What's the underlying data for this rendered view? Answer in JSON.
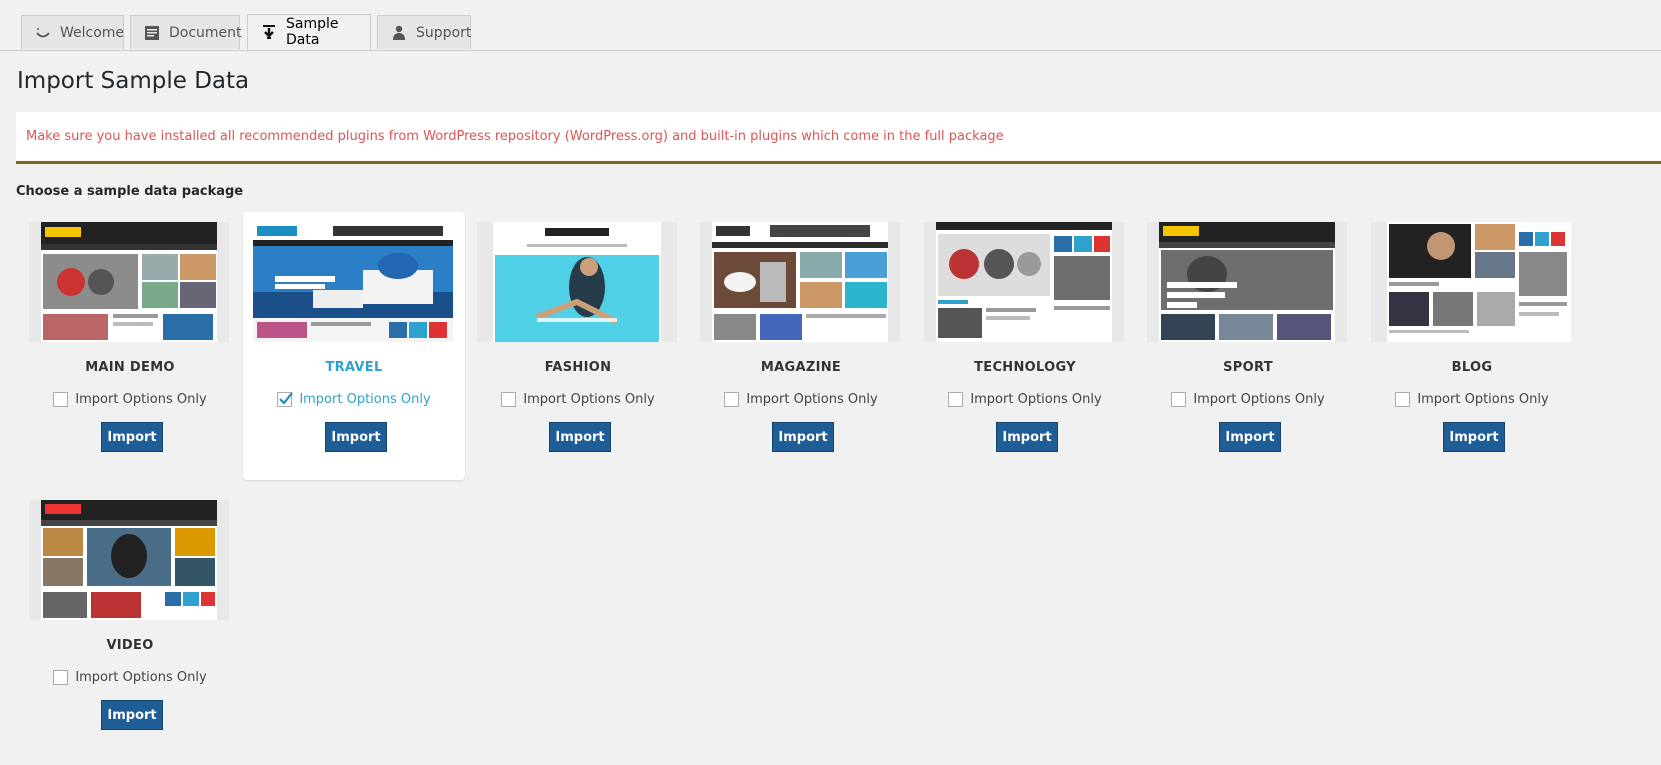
{
  "tabs": [
    {
      "label": "Welcome",
      "icon": "smile-icon",
      "active": false
    },
    {
      "label": "Document",
      "icon": "document-icon",
      "active": false
    },
    {
      "label": "Sample Data",
      "icon": "download-icon",
      "active": true
    },
    {
      "label": "Support",
      "icon": "support-person-icon",
      "active": false
    }
  ],
  "page": {
    "title": "Import Sample Data",
    "notice": "Make sure you have installed all recommended plugins from WordPress repository (WordPress.org) and built-in plugins which come in the full package",
    "subtitle": "Choose a sample data package"
  },
  "colors": {
    "notice_text": "#dd5555",
    "notice_border": "#7a6a16",
    "button": "#1f5d96",
    "selected_accent": "#2ea2cc"
  },
  "packages": [
    {
      "name": "MAIN DEMO",
      "option_label": "Import Options Only",
      "checked": false,
      "button_label": "Import",
      "selected": false
    },
    {
      "name": "TRAVEL",
      "option_label": "Import Options Only",
      "checked": true,
      "button_label": "Import",
      "selected": true
    },
    {
      "name": "FASHION",
      "option_label": "Import Options Only",
      "checked": false,
      "button_label": "Import",
      "selected": false
    },
    {
      "name": "MAGAZINE",
      "option_label": "Import Options Only",
      "checked": false,
      "button_label": "Import",
      "selected": false
    },
    {
      "name": "TECHNOLOGY",
      "option_label": "Import Options Only",
      "checked": false,
      "button_label": "Import",
      "selected": false
    },
    {
      "name": "SPORT",
      "option_label": "Import Options Only",
      "checked": false,
      "button_label": "Import",
      "selected": false
    },
    {
      "name": "BLOG",
      "option_label": "Import Options Only",
      "checked": false,
      "button_label": "Import",
      "selected": false
    },
    {
      "name": "VIDEO",
      "option_label": "Import Options Only",
      "checked": false,
      "button_label": "Import",
      "selected": false
    }
  ]
}
